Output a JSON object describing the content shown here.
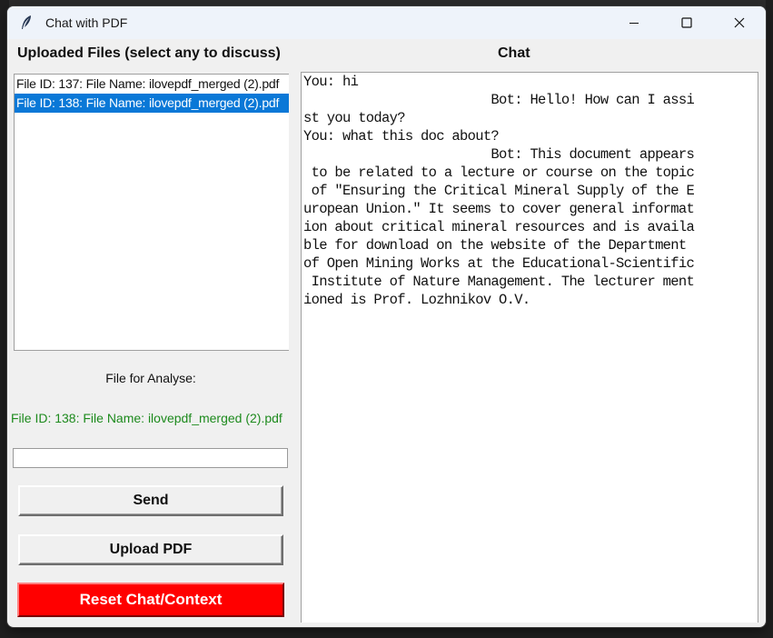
{
  "window": {
    "title": "Chat with PDF"
  },
  "files_panel": {
    "heading": "Uploaded Files (select any to discuss)",
    "items": [
      {
        "label": "File ID: 137: File Name: ilovepdf_merged (2).pdf",
        "selected": false
      },
      {
        "label": "File ID: 138: File Name: ilovepdf_merged (2).pdf",
        "selected": true
      }
    ]
  },
  "analyse": {
    "label": "File for Analyse:",
    "file": "File ID: 138: File Name: ilovepdf_merged (2).pdf",
    "color": "#1d8a1d"
  },
  "input": {
    "value": ""
  },
  "buttons": {
    "send": "Send",
    "upload": "Upload PDF",
    "reset": "Reset Chat/Context",
    "reset_color": "#ff0000"
  },
  "chat": {
    "heading": "Chat",
    "lines": [
      "You: hi",
      "                        Bot: Hello! How can I assi",
      "st you today?",
      "You: what this doc about?",
      "                        Bot: This document appears",
      " to be related to a lecture or course on the topic",
      " of \"Ensuring the Critical Mineral Supply of the E",
      "uropean Union.\" It seems to cover general informat",
      "ion about critical mineral resources and is availa",
      "ble for download on the website of the Department ",
      "of Open Mining Works at the Educational-Scientific",
      " Institute of Nature Management. The lecturer ment",
      "ioned is Prof. Lozhnikov O.V."
    ]
  }
}
